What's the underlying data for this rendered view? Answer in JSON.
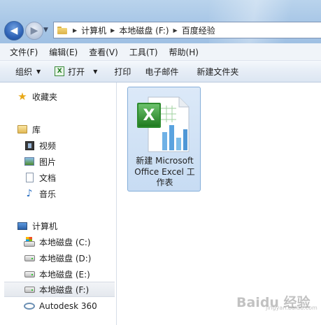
{
  "address": {
    "crumbs": [
      "计算机",
      "本地磁盘 (F:)",
      "百度经验"
    ]
  },
  "menu": [
    "文件(F)",
    "编辑(E)",
    "查看(V)",
    "工具(T)",
    "帮助(H)"
  ],
  "toolbar": {
    "organize": "组织",
    "open": "打开",
    "print": "打印",
    "email": "电子邮件",
    "new_folder": "新建文件夹"
  },
  "navpane": {
    "favorites": "收藏夹",
    "libraries": "库",
    "videos": "视频",
    "pictures": "图片",
    "documents": "文档",
    "music": "音乐",
    "computer": "计算机",
    "drive_c": "本地磁盘 (C:)",
    "drive_d": "本地磁盘 (D:)",
    "drive_e": "本地磁盘 (E:)",
    "drive_f": "本地磁盘 (F:)",
    "autodesk": "Autodesk 360"
  },
  "files": [
    {
      "name_lines": [
        "新建 Microsoft",
        "Office Excel 工",
        "作表"
      ],
      "icon": "excel-worksheet-icon",
      "selected": true
    }
  ],
  "watermark": {
    "logo": "Baidu 经验",
    "url": "jingyan.baidu.com"
  },
  "colors": {
    "accent": "#2f63b6",
    "selection": "#cfe0f5",
    "excel_green": "#1f7a1f"
  }
}
